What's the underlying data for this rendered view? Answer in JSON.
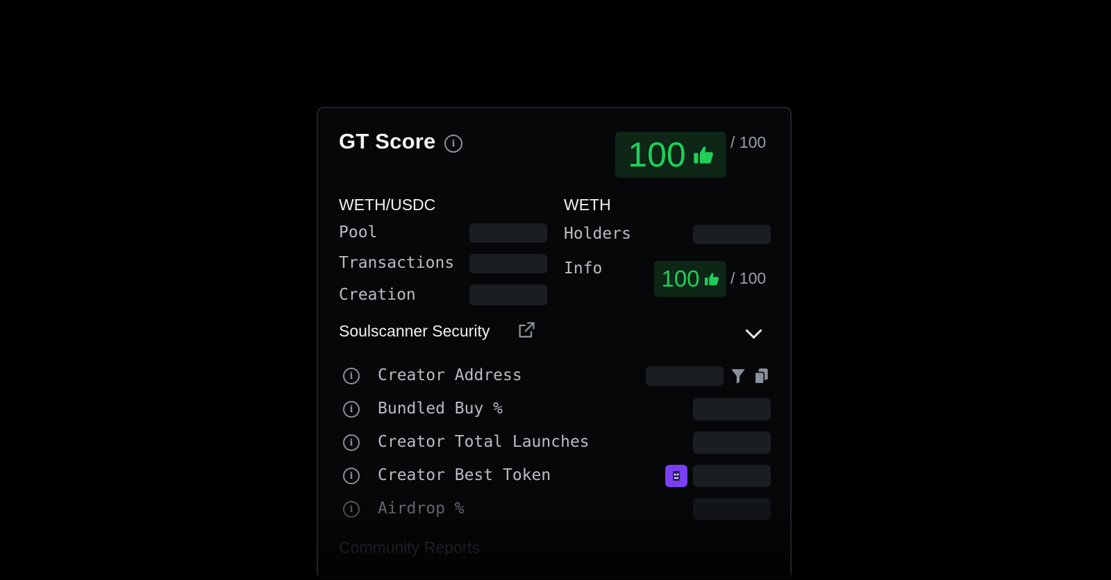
{
  "header": {
    "title": "GT Score",
    "score": "100",
    "score_max": "/ 100"
  },
  "pool_section": {
    "heading": "WETH/USDC",
    "rows": [
      {
        "label": "Pool"
      },
      {
        "label": "Transactions"
      },
      {
        "label": "Creation"
      }
    ]
  },
  "token_section": {
    "heading": "WETH",
    "holders_label": "Holders",
    "info_label": "Info",
    "info_score": "100",
    "info_score_max": "/ 100"
  },
  "security": {
    "heading": "Soulscanner Security",
    "rows": [
      {
        "label": "Creator Address"
      },
      {
        "label": "Bundled Buy %"
      },
      {
        "label": "Creator Total Launches"
      },
      {
        "label": "Creator Best Token"
      },
      {
        "label": "Airdrop %"
      }
    ]
  },
  "community": {
    "heading": "Community Reports"
  },
  "colors": {
    "accent_green": "#1fcf5a",
    "badge_bg": "#0d2616",
    "skeleton": "#1a1d22",
    "token_icon": "#7b3ff2"
  },
  "icons": {
    "info": "info-circle-icon",
    "thumbs_up": "thumbs-up-icon",
    "external_link": "external-link-icon",
    "chevron": "chevron-down-icon",
    "filter": "filter-icon",
    "copy": "copy-icon",
    "token": "token-avatar-icon"
  }
}
